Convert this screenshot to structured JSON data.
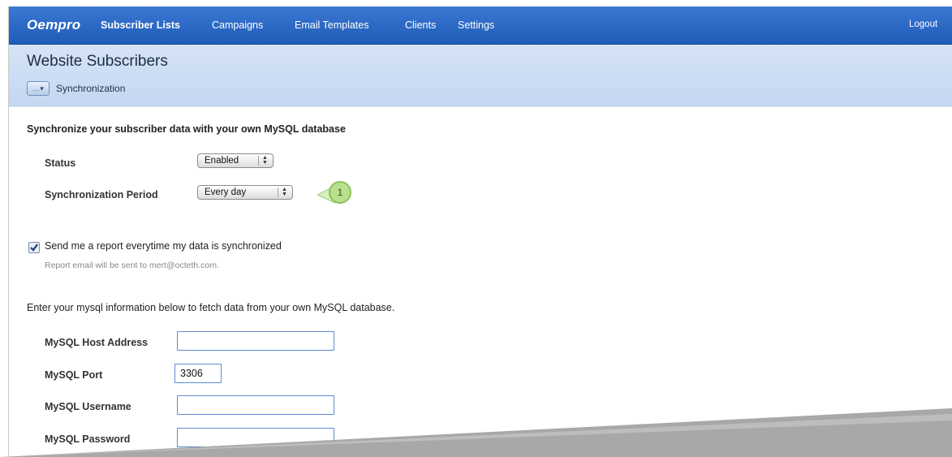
{
  "nav": {
    "logo": "Oempro",
    "items": [
      {
        "label": "Subscriber Lists",
        "active": true
      },
      {
        "label": "Campaigns"
      },
      {
        "label": "Email Templates"
      },
      {
        "label": "Clients"
      },
      {
        "label": "Settings"
      }
    ],
    "logout": "Logout"
  },
  "header": {
    "title": "Website Subscribers",
    "dropdown_icon": "ellipsis-dropdown-icon",
    "subnav_label": "Synchronization"
  },
  "sync": {
    "section_title": "Synchronize your subscriber data with your own MySQL database",
    "status_label": "Status",
    "status_value": "Enabled",
    "period_label": "Synchronization Period",
    "period_value": "Every day",
    "callout_number": "1",
    "callout_color": "#8fcf4a",
    "report_checkbox_label": "Send me a report everytime my data is synchronized",
    "report_checked": true,
    "report_note": "Report email will be sent to mert@octeth.com."
  },
  "mysql": {
    "intro": "Enter your mysql information below to fetch data from your own MySQL database.",
    "host_label": "MySQL Host Address",
    "host_value": "",
    "port_label": "MySQL Port",
    "port_value": "3306",
    "username_label": "MySQL Username",
    "username_value": "",
    "password_label": "MySQL Password",
    "password_value": ""
  },
  "colors": {
    "nav_bg": "#2a68c6",
    "header_bg": "#cddff5",
    "input_border": "#5b8ad6"
  }
}
